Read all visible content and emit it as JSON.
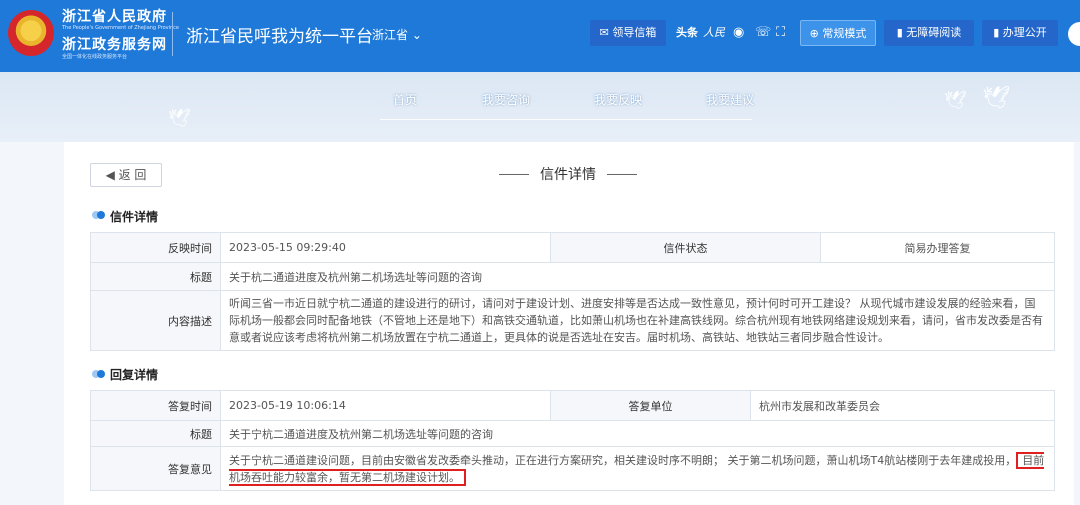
{
  "header": {
    "gov_title": "浙江省人民政府",
    "gov_subtitle": "The People's Government of Zhejiang Province",
    "service_title": "浙江政务服务网",
    "service_subtitle": "全国一体化在线政务服务平台",
    "platform_title": "浙江省民呼我为统一平台",
    "region": "浙江省 ⌄",
    "toolbar": {
      "leader_mail": "领导信箱",
      "normal_mode": "常规模式",
      "accessible_read": "无障碍阅读",
      "open_affairs": "办理公开"
    },
    "icons": [
      "mail-icon",
      "toutiao-icon",
      "people-daily-icon",
      "wechat-icon",
      "phone-icon",
      "scan-icon"
    ]
  },
  "nav": {
    "items": [
      "首页",
      "我要咨询",
      "我要反映",
      "我要建议"
    ]
  },
  "page": {
    "back_label": "◀ 返 回",
    "heading": "信件详情"
  },
  "letter": {
    "section_title": "信件详情",
    "time_label": "反映时间",
    "time": "2023-05-15 09:29:40",
    "status_label": "信件状态",
    "status": "简易办理答复",
    "subject_label": "标题",
    "subject": "关于杭二通道进度及杭州第二机场选址等问题的咨询",
    "content_label": "内容描述",
    "content": "听闻三省一市近日就宁杭二通道的建设进行的研讨，请问对于建设计划、进度安排等是否达成一致性意见，预计何时可开工建设？ 从现代城市建设发展的经验来看，国际机场一般都会同时配备地铁（不管地上还是地下）和高铁交通轨道，比如萧山机场也在补建高铁线网。综合杭州现有地铁网络建设规划来看，请问，省市发改委是否有意或者说应该考虑将杭州第二机场放置在宁杭二通道上，更具体的说是否选址在安吉。届时机场、高铁站、地铁站三者同步融合性设计。"
  },
  "reply": {
    "section_title": "回复详情",
    "time_label": "答复时间",
    "time": "2023-05-19 10:06:14",
    "unit_label": "答复单位",
    "unit": "杭州市发展和改革委员会",
    "subject_label": "标题",
    "subject": "关于宁杭二通道进度及杭州第二机场选址等问题的咨询",
    "opinion_label": "答复意见",
    "opinion_part1": "关于宁杭二通道建设问题，目前由安徽省发改委牵头推动，正在进行方案研究，相关建设时序不明朗； 关于第二机场问题，萧山机场T4航站楼刚于去年建成投用，",
    "opinion_highlight": "目前机场吞吐能力较富余，暂无第二机场建设计划。"
  },
  "colors": {
    "brand": "#1e79d8",
    "highlight": "#e02020"
  }
}
